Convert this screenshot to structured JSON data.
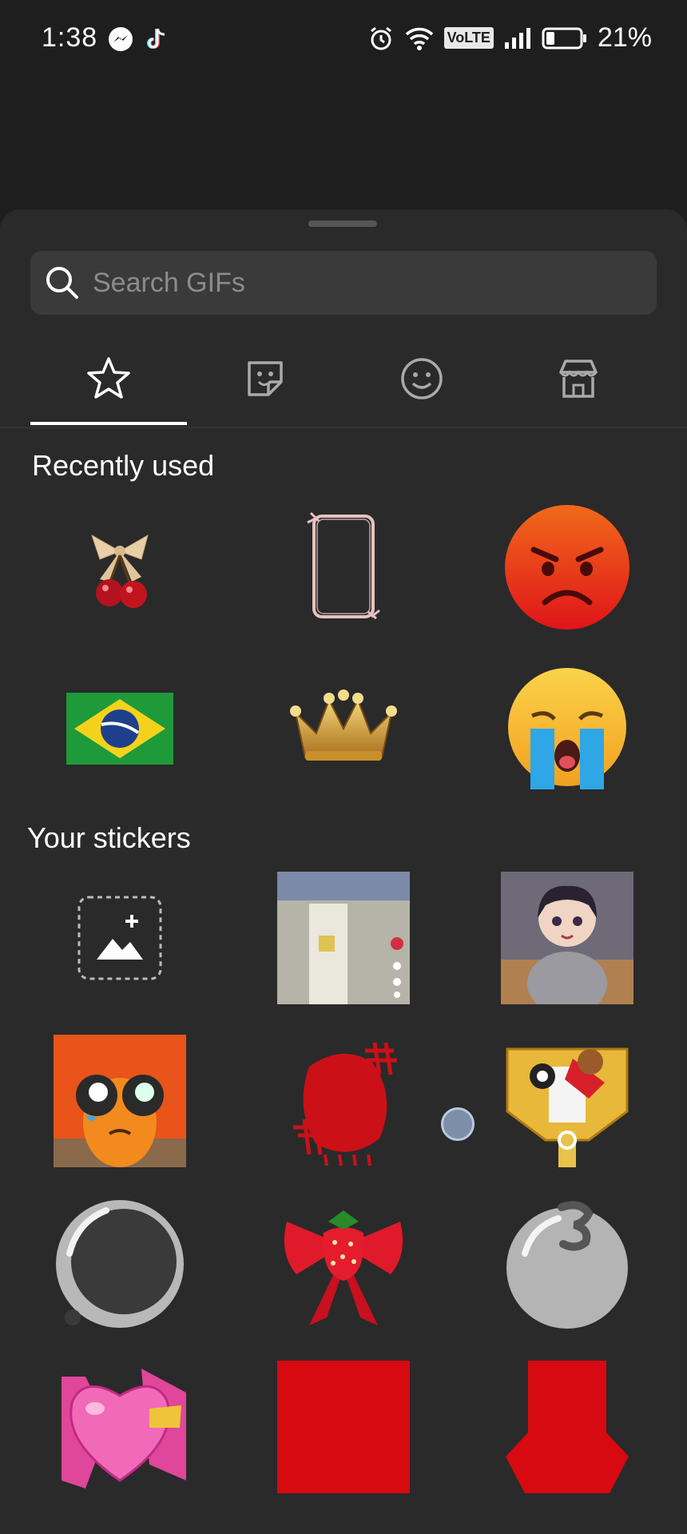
{
  "status_bar": {
    "time": "1:38",
    "network": "VoLTE",
    "battery": "21%"
  },
  "search": {
    "placeholder": "Search GIFs"
  },
  "tabs": [
    {
      "icon": "star-icon",
      "active": true
    },
    {
      "icon": "sticker-icon",
      "active": false
    },
    {
      "icon": "smiley-icon",
      "active": false
    },
    {
      "icon": "store-icon",
      "active": false
    }
  ],
  "sections": {
    "recent_title": "Recently used",
    "stickers_title": "Your stickers"
  },
  "recent_items": [
    "cherries-bow",
    "ribbon-frame",
    "angry-face",
    "brazil-flag",
    "gold-crown",
    "crying-face"
  ],
  "sticker_items": [
    "add-sticker",
    "screenshot",
    "anime-girl",
    "crying-orange",
    "red-scribble",
    "gold-character",
    "gray-ball",
    "strawberry-bow",
    "gray-ball-three",
    "pink-heart",
    "red-square",
    "red-arrow"
  ],
  "colors": {
    "background": "#1e1e1e",
    "sheet": "#2a2a2a",
    "search_bg": "#3a3a3a",
    "accent": "#ffffff"
  }
}
